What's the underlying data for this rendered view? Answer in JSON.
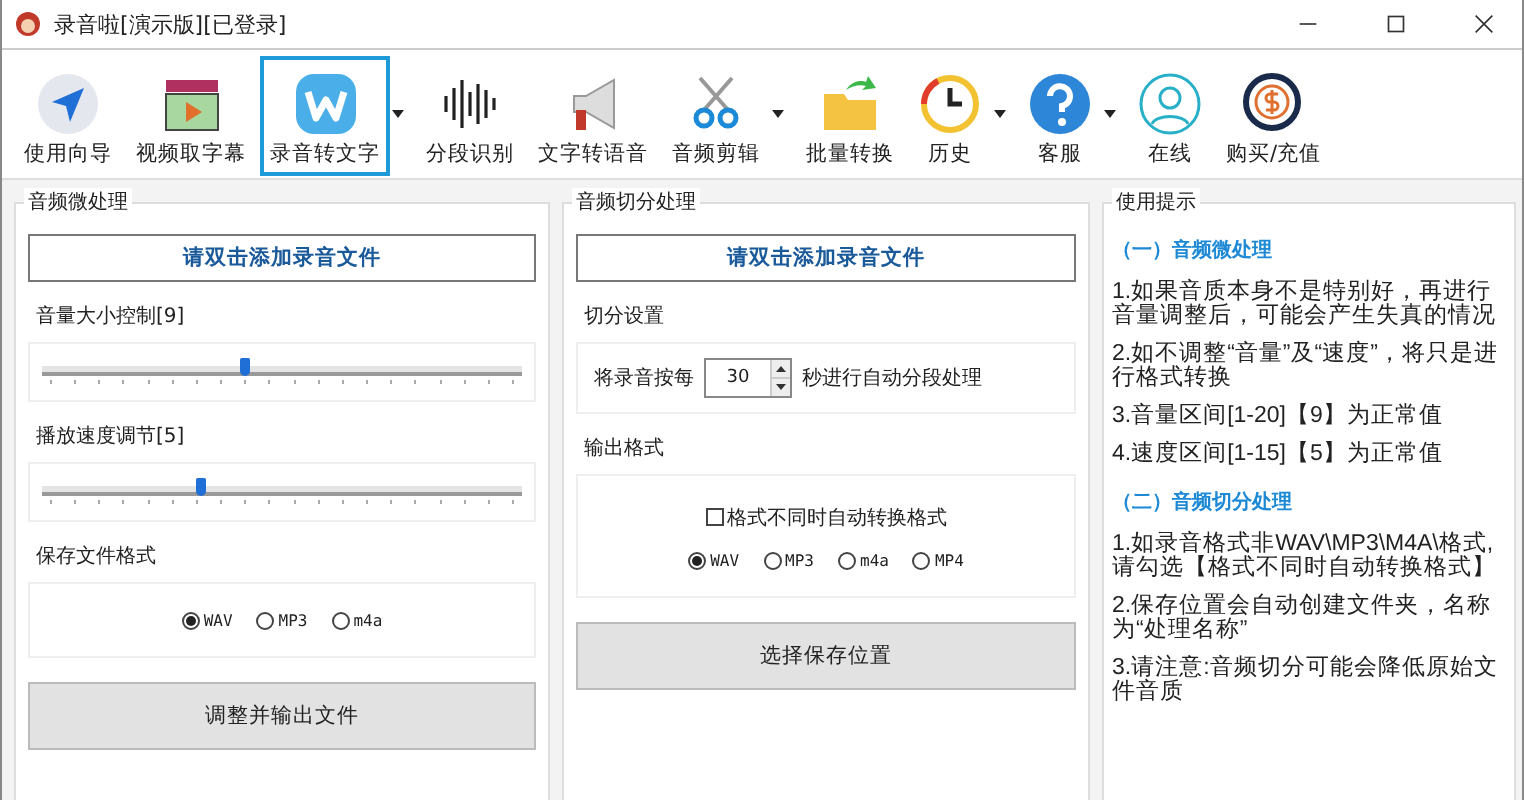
{
  "window": {
    "title": "录音啦[演示版][已登录]"
  },
  "toolbar": [
    {
      "label": "使用向导",
      "kind": "navigate",
      "selected": false,
      "dropdown": false
    },
    {
      "label": "视频取字幕",
      "kind": "video",
      "selected": false,
      "dropdown": false
    },
    {
      "label": "录音转文字",
      "kind": "w",
      "selected": true,
      "dropdown": true
    },
    {
      "label": "分段识别",
      "kind": "wave",
      "selected": false,
      "dropdown": false
    },
    {
      "label": "文字转语音",
      "kind": "megaphone",
      "selected": false,
      "dropdown": false
    },
    {
      "label": "音频剪辑",
      "kind": "scissors",
      "selected": false,
      "dropdown": true
    },
    {
      "label": "批量转换",
      "kind": "folder",
      "selected": false,
      "dropdown": false
    },
    {
      "label": "历史",
      "kind": "history",
      "selected": false,
      "dropdown": true
    },
    {
      "label": "客服",
      "kind": "help",
      "selected": false,
      "dropdown": true
    },
    {
      "label": "在线",
      "kind": "user",
      "selected": false,
      "dropdown": false
    },
    {
      "label": "购买/充值",
      "kind": "coin",
      "selected": false,
      "dropdown": false
    }
  ],
  "left_panel": {
    "title": "音频微处理",
    "add_button": "请双击添加录音文件",
    "sliders": [
      {
        "label": "音量大小控制[9]",
        "level": 0.42
      },
      {
        "label": "播放速度调节[5]",
        "level": 0.33
      }
    ],
    "format_label": "保存文件格式",
    "formats": [
      {
        "label": "WAV",
        "selected": true
      },
      {
        "label": "MP3",
        "selected": false
      },
      {
        "label": "m4a",
        "selected": false
      }
    ],
    "action_button": "调整并输出文件"
  },
  "middle_panel": {
    "title": "音频切分处理",
    "add_button": "请双击添加录音文件",
    "split_label": "切分设置",
    "split_prefix": "将录音按每",
    "split_value": "30",
    "split_suffix": "秒进行自动分段处理",
    "output_label": "输出格式",
    "auto_convert": {
      "label": "格式不同时自动转换格式",
      "checked": false
    },
    "formats": [
      {
        "label": "WAV",
        "selected": true
      },
      {
        "label": "MP3",
        "selected": false
      },
      {
        "label": "m4a",
        "selected": false
      },
      {
        "label": "MP4",
        "selected": false
      }
    ],
    "action_button": "选择保存位置"
  },
  "tips_panel": {
    "title": "使用提示",
    "sections": [
      {
        "heading": "（一）音频微处理",
        "items": [
          "1.如果音质本身不是特别好，再进行音量调整后，可能会产生失真的情况",
          "2.如不调整“音量”及“速度”，将只是进行格式转换",
          "3.音量区间[1-20]【9】为正常值",
          "4.速度区间[1-15]【5】为正常值"
        ]
      },
      {
        "heading": "（二）音频切分处理",
        "items": [
          "1.如录音格式非WAV\\MP3\\M4A\\格式,请勾选【格式不同时自动转换格式】",
          "2.保存位置会自动创建文件夹，名称为“处理名称”",
          "3.请注意:音频切分可能会降低原始文件音质"
        ]
      }
    ]
  }
}
